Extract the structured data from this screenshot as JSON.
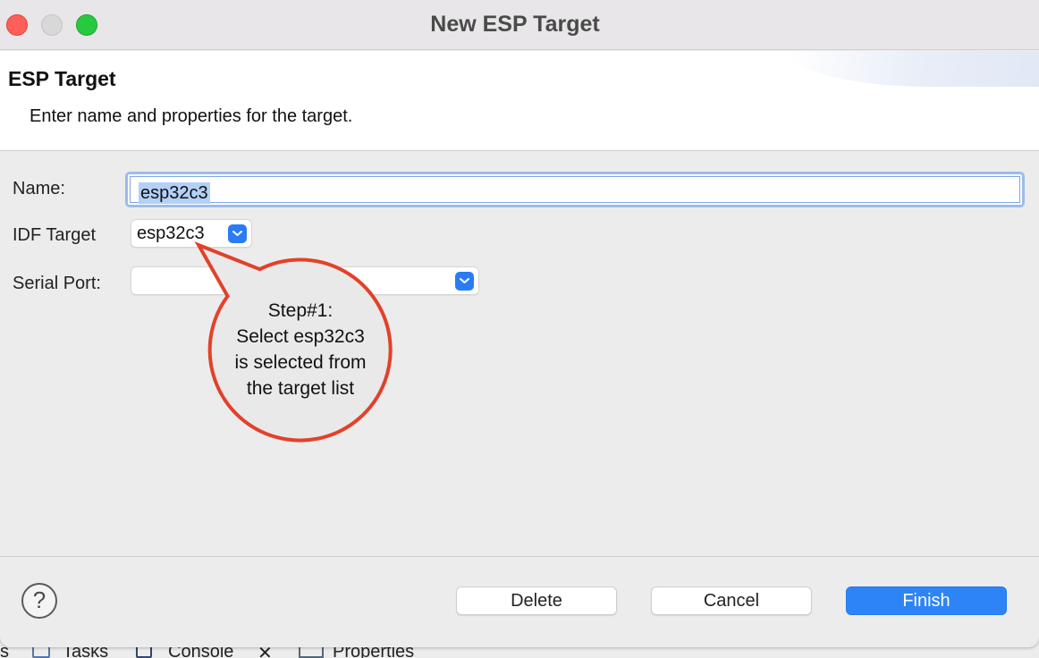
{
  "window": {
    "title": "New ESP Target"
  },
  "header": {
    "title": "ESP Target",
    "description": "Enter name and properties for the target."
  },
  "form": {
    "name_label": "Name:",
    "name_value": "esp32c3",
    "idf_target_label": "IDF Target",
    "idf_target_value": "esp32c3",
    "serial_port_label": "Serial Port:",
    "serial_port_value": ""
  },
  "callout": {
    "lines": [
      "Step#1:",
      "Select esp32c3",
      "is selected from",
      "the target list"
    ]
  },
  "buttons": {
    "help": "?",
    "delete": "Delete",
    "cancel": "Cancel",
    "finish": "Finish"
  },
  "background_tabs": {
    "tasks": "Tasks",
    "console": "Console",
    "properties": "Properties",
    "cut_left": "s"
  },
  "colors": {
    "accent": "#2d84f7",
    "callout_border": "#e2412a",
    "selection": "#b3d0f7"
  }
}
